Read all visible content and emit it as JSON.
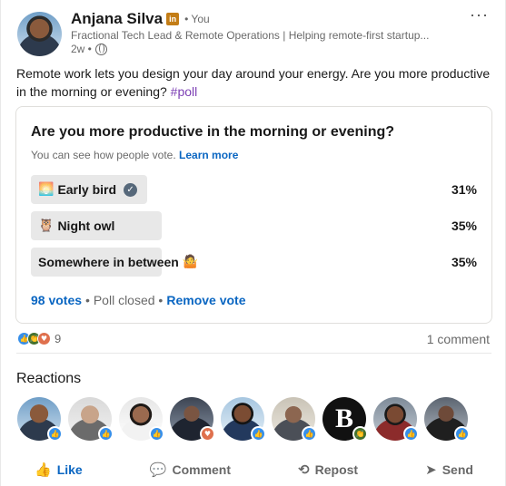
{
  "author": {
    "name": "Anjana Silva",
    "badge": "in",
    "you_label": "• You",
    "headline": "Fractional Tech Lead & Remote Operations | Helping remote-first startup...",
    "time": "2w •",
    "more_label": "···"
  },
  "post": {
    "text": "Remote work lets you design your day around your energy. Are you more productive in the morning or evening?",
    "hashtag": "#poll"
  },
  "poll": {
    "question": "Are you more productive in the morning or evening?",
    "note": "You can see how people vote.",
    "learn_more": "Learn more",
    "options": [
      {
        "label": "Early bird",
        "emoji": "🌅",
        "percent_text": "31%",
        "fraction": 0.31,
        "selected": true
      },
      {
        "label": "Night owl",
        "emoji": "🦉",
        "percent_text": "35%",
        "fraction": 0.35,
        "selected": false
      },
      {
        "label": "Somewhere in between",
        "emoji": "🤷",
        "percent_text": "35%",
        "fraction": 0.35,
        "selected": false
      }
    ],
    "votes": "98 votes",
    "status": "• Poll closed •",
    "remove_vote": "Remove vote"
  },
  "social": {
    "reaction_count": "9",
    "comments": "1 comment"
  },
  "reactions_section": {
    "title": "Reactions",
    "badge_monogram": "B"
  },
  "actions": {
    "like": "Like",
    "comment": "Comment",
    "repost": "Repost",
    "send": "Send"
  },
  "colors": {
    "brand_blue": "#0a66c2",
    "hashtag_purple": "#7c3fb4",
    "poll_bar": "#e8e8e8"
  }
}
